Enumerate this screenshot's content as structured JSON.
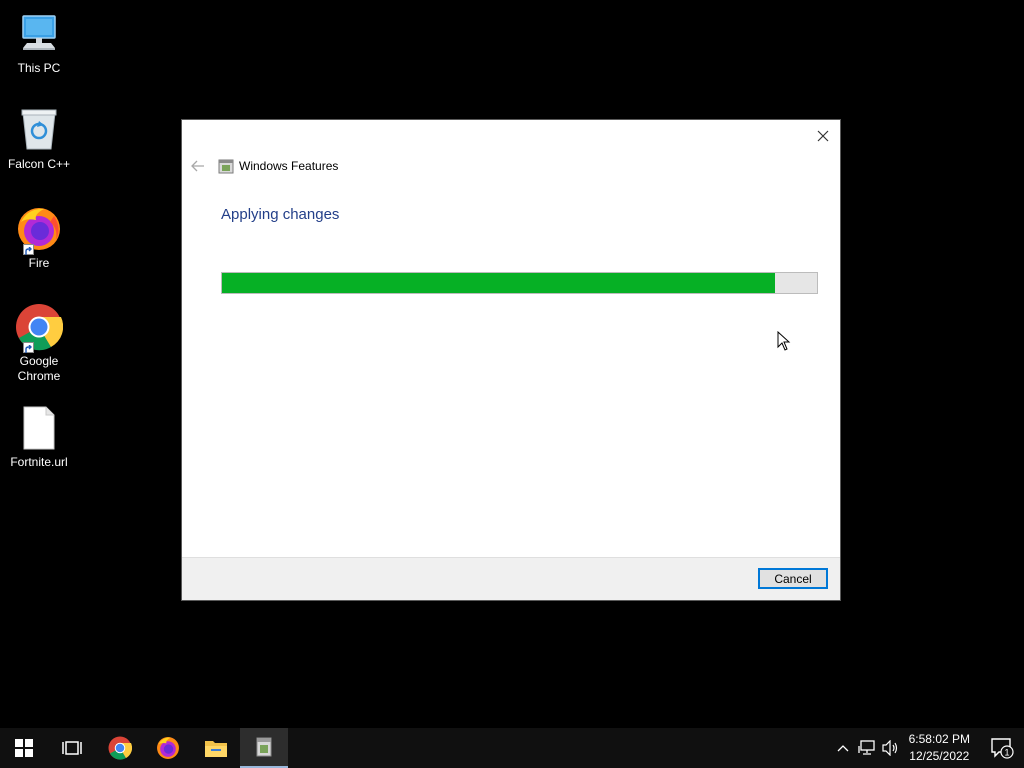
{
  "desktop": {
    "icons": [
      {
        "label": "This PC",
        "icon": "this-pc-icon"
      },
      {
        "label": "Falcon C++",
        "icon": "recycle-bin-icon"
      },
      {
        "label": "Fire",
        "icon": "firefox-icon"
      },
      {
        "label": "Google Chrome",
        "icon": "chrome-icon"
      },
      {
        "label": "Fortnite.url",
        "icon": "file-icon"
      }
    ]
  },
  "dialog": {
    "title": "Windows Features",
    "heading": "Applying changes",
    "progress_percent": 93,
    "cancel_label": "Cancel",
    "colors": {
      "progress_fill": "#06b025",
      "heading": "#233f89",
      "button_border": "#0078d7"
    }
  },
  "taskbar": {
    "items": [
      {
        "icon": "windows-start-icon"
      },
      {
        "icon": "task-view-icon"
      },
      {
        "icon": "chrome-icon"
      },
      {
        "icon": "firefox-icon"
      },
      {
        "icon": "file-explorer-icon"
      },
      {
        "icon": "windows-features-icon",
        "active": true
      }
    ],
    "tray": {
      "time": "6:58:02 PM",
      "date": "12/25/2022",
      "notification_count": "1"
    }
  }
}
